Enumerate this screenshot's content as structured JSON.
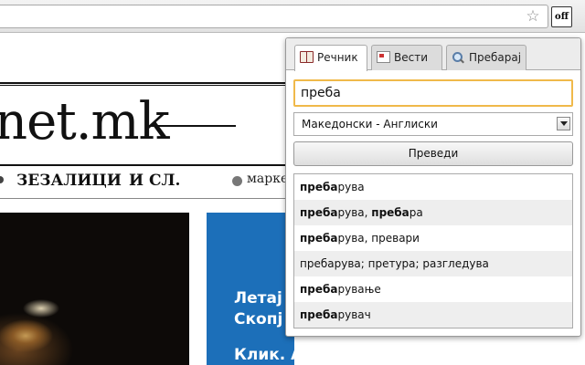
{
  "browser": {
    "extension_button_label": "off",
    "star_glyph": "☆"
  },
  "page": {
    "logo_text": "net.mk",
    "nav_items": [
      "ЗЕЗАЛИЦИ",
      "И СЛ."
    ],
    "nav_market": "марке",
    "ad_lines": [
      "Летај",
      "Скопј",
      "Клик. Аіде да патуваме!"
    ]
  },
  "popup": {
    "tabs": [
      {
        "label": "Речник",
        "icon": "dictionary-icon",
        "active": true
      },
      {
        "label": "Вести",
        "icon": "news-icon",
        "active": false
      },
      {
        "label": "Пребарај",
        "icon": "search-icon",
        "active": false
      }
    ],
    "search_value": "преба",
    "language_selected": "Македонски - Англиски",
    "translate_label": "Преведи",
    "results": [
      [
        {
          "t": "преба",
          "b": true
        },
        {
          "t": "рува",
          "b": false
        }
      ],
      [
        {
          "t": "преба",
          "b": true
        },
        {
          "t": "рува, ",
          "b": false
        },
        {
          "t": "преба",
          "b": true
        },
        {
          "t": "ра",
          "b": false
        }
      ],
      [
        {
          "t": "преба",
          "b": true
        },
        {
          "t": "рува, превари",
          "b": false
        }
      ],
      [
        {
          "t": "пребарува; претура; разгледува",
          "b": false
        }
      ],
      [
        {
          "t": "преба",
          "b": true
        },
        {
          "t": "рување",
          "b": false
        }
      ],
      [
        {
          "t": "преба",
          "b": true
        },
        {
          "t": "рувач",
          "b": false
        }
      ]
    ]
  },
  "colors": {
    "input_focus_border": "#f0b94a",
    "ad_blue": "#1c6fb9"
  }
}
